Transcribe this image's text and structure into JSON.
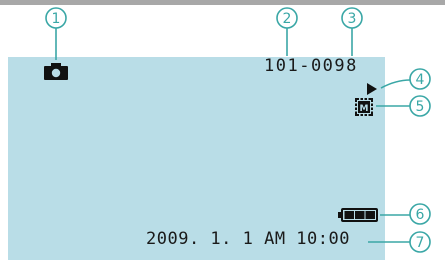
{
  "screen": {
    "file_number": "101-0098",
    "datetime": "2009. 1.  1 AM 10:00",
    "mode_icon": "camera-icon",
    "playback_icon": "play-icon",
    "media_icon": "memory-card-icon",
    "battery_icon": "battery-icon",
    "battery_level": 1.0
  },
  "callouts": [
    "1",
    "2",
    "3",
    "4",
    "5",
    "6",
    "7"
  ],
  "colors": {
    "screen_background": "#b9dde7",
    "callout": "#3aa7a6",
    "text": "#1a1a1a",
    "top_bar": "#a8a8a8"
  }
}
